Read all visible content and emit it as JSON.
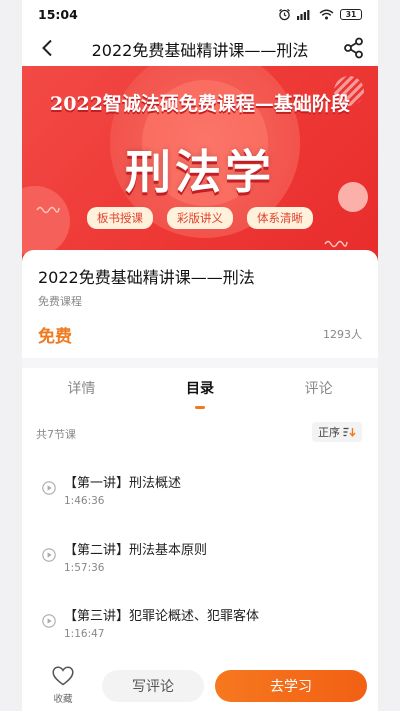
{
  "status_bar": {
    "time": "15:04",
    "battery": "31"
  },
  "nav": {
    "title": "2022免费基础精讲课——刑法"
  },
  "banner": {
    "headline": "2022智诚法硕免费课程—基础阶段",
    "subject": "刑法学",
    "tags": [
      "板书授课",
      "彩版讲义",
      "体系清晰"
    ]
  },
  "course": {
    "title": "2022免费基础精讲课——刑法",
    "type": "免费课程",
    "price": "免费",
    "students": "1293人"
  },
  "tabs": [
    {
      "label": "详情",
      "active": false
    },
    {
      "label": "目录",
      "active": true
    },
    {
      "label": "评论",
      "active": false
    }
  ],
  "catalog": {
    "total": "共7节课",
    "sort_label": "正序",
    "lessons": [
      {
        "name": "【第一讲】刑法概述",
        "duration": "1:46:36"
      },
      {
        "name": "【第二讲】刑法基本原则",
        "duration": "1:57:36"
      },
      {
        "name": "【第三讲】犯罪论概述、犯罪客体",
        "duration": "1:16:47"
      }
    ]
  },
  "bottom_bar": {
    "favorite_label": "收藏",
    "comment_label": "写评论",
    "study_label": "去学习"
  },
  "colors": {
    "accent": "#f07a1d",
    "banner_red": "#ef3b37",
    "tag_bg": "#fff1dc"
  }
}
